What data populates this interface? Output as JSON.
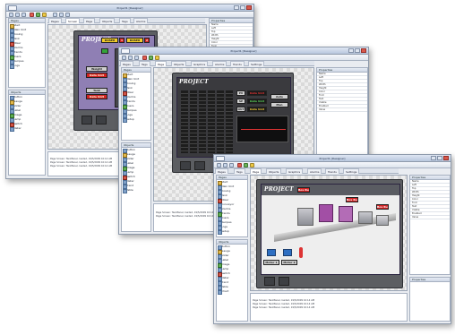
{
  "brand": "PROJECT",
  "windows": [
    {
      "title": "Project1 [Designer]",
      "tabs": [
        "Pages",
        "Screen",
        "Page",
        "Objects",
        "Tags",
        "Alarms"
      ],
      "active_tab": 1,
      "tree_header": "Pages",
      "tree_items": [
        "Start",
        "Main Unit",
        "Dosing",
        "Tank",
        "Mixer",
        "Alarms",
        "Trends",
        "Users",
        "Recipes",
        "Logs"
      ],
      "controls_header": "Objects",
      "control_items": [
        "Button",
        "Gauge",
        "Slider",
        "Label",
        "Image",
        "Lamp",
        "Switch",
        "Meter"
      ],
      "props_header": "Properties",
      "prop_rows": [
        "Name",
        "Left",
        "Top",
        "Width",
        "Height",
        "Color",
        "Font",
        "Text",
        "Visible",
        "Enabled"
      ],
      "output_lines": [
        "Page Screen: TankPanel, loaded, 19/5/2009 10:14 AM",
        "Page Screen: TankPanel, loaded, 19/5/2009 10:14 AM",
        "Page Screen: TankPanel, loaded, 19/5/2009 10:14 AM"
      ],
      "hmi": {
        "doser1": "DOSER",
        "doser2": "DOSER",
        "num1": "1",
        "num2": "2",
        "weight": "Weight",
        "tank": "Tank",
        "val1": "Data Unit",
        "val2": "Data Unit"
      }
    },
    {
      "title": "Project1 [Designer]",
      "tabs": [
        "Pages",
        "Tags",
        "Page",
        "Objects",
        "Graphics",
        "Alarms",
        "Trends",
        "Settings"
      ],
      "active_tab": 2,
      "tree_header": "Pages",
      "tree_items": [
        "Start",
        "Main Unit",
        "Dosing",
        "Tank",
        "Mixer",
        "Alarms",
        "Trends",
        "Users",
        "Recipes",
        "Logs",
        "Setup"
      ],
      "controls_header": "Objects",
      "control_items": [
        "Button",
        "Gauge",
        "Slider",
        "Label",
        "Image",
        "Lamp",
        "Switch",
        "Meter",
        "Trend",
        "Table"
      ],
      "props_header": "Properties",
      "prop_rows": [
        "Name",
        "Left",
        "Top",
        "Width",
        "Height",
        "Color",
        "Font",
        "Text",
        "Visible",
        "Enabled",
        "Value"
      ],
      "output_lines": [
        "Page Screen: TankPanel, loaded, 19/5/2009 10:14 AM",
        "Page Screen: TankPanel, loaded, 19/5/2009 10:14 AM"
      ],
      "hmi": {
        "pv": "PV",
        "sp": "SP",
        "out": "OUT",
        "pv_val": "Data Unit",
        "sp_val": "Data Unit",
        "out_val": "Data Unit",
        "auto": "Auto",
        "man": "Man"
      }
    },
    {
      "title": "Project1 [Designer]",
      "tabs": [
        "Pages",
        "Tags",
        "Page",
        "Objects",
        "Graphics",
        "Alarms",
        "Trends",
        "Settings"
      ],
      "active_tab": 2,
      "tree_header": "Pages",
      "tree_items": [
        "Start",
        "Main Unit",
        "Dosing",
        "Tank",
        "Mixer",
        "Conveyor",
        "Alarms",
        "Trends",
        "Users",
        "Recipes",
        "Logs",
        "Setup"
      ],
      "controls_header": "Objects",
      "control_items": [
        "Button",
        "Gauge",
        "Slider",
        "Label",
        "Image",
        "Lamp",
        "Switch",
        "Meter",
        "Trend",
        "Table",
        "Chart"
      ],
      "props_header": "Properties",
      "prop_rows": [
        "Name",
        "Left",
        "Top",
        "Width",
        "Height",
        "Color",
        "Font",
        "Text",
        "Visible",
        "Enabled",
        "Value"
      ],
      "output_lines": [
        "Page Screen: TankPanel, loaded, 19/5/2009 10:14 AM",
        "Page Screen: TankPanel, loaded, 19/5/2009 10:14 AM",
        "Page Screen: TankPanel, loaded, 19/5/2009 10:14 AM"
      ],
      "hmi": {
        "motor1": "Motor 1",
        "motor2": "Motor 2",
        "badge1": "Box Run",
        "badge2": "Box Run",
        "badge3": "Box Run"
      }
    }
  ]
}
